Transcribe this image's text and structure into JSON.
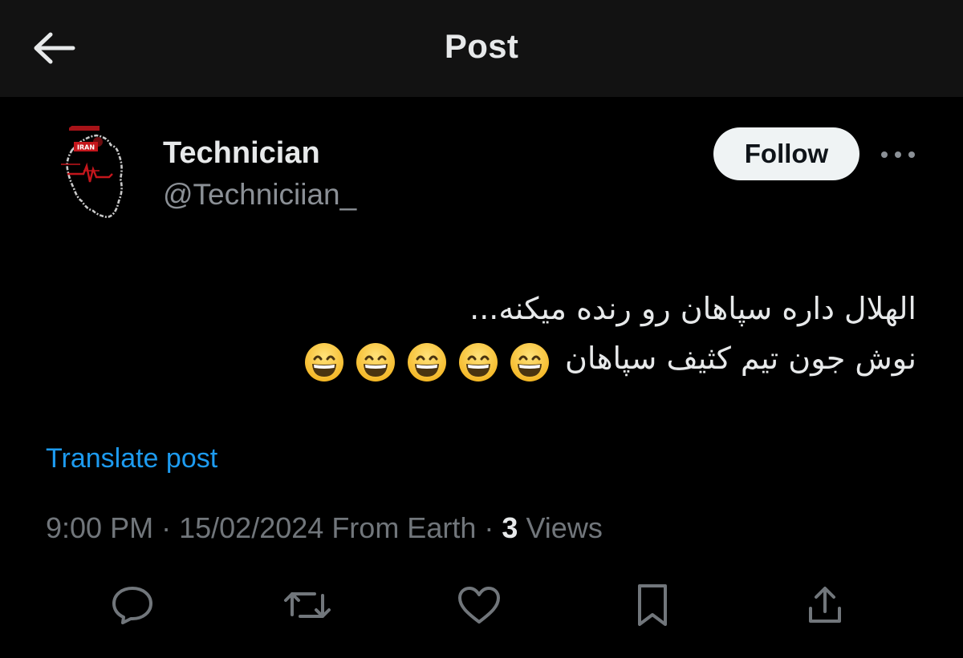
{
  "header": {
    "title": "Post",
    "back_icon": "arrow-left-icon"
  },
  "author": {
    "display_name": "Technician",
    "handle": "@Techniciian_",
    "avatar_text": "IRAN",
    "follow_label": "Follow",
    "more_icon": "more-horizontal-icon"
  },
  "post": {
    "line1": "الهلال داره سپاهان رو رنده میکنه...",
    "line2": "نوش جون تیم کثیف سپاهان",
    "emoji_name": "grinning-face-with-smiling-eyes-emoji",
    "emoji_count": 5,
    "translate_label": "Translate post",
    "time": "9:00 PM",
    "date": "15/02/2024",
    "source": "From Earth",
    "views_count": "3",
    "views_label": "Views",
    "separator": "·"
  },
  "actions": {
    "reply_icon": "reply-icon",
    "repost_icon": "repost-icon",
    "like_icon": "heart-icon",
    "bookmark_icon": "bookmark-icon",
    "share_icon": "share-icon"
  },
  "colors": {
    "background": "#000000",
    "header_background": "#121212",
    "text_primary": "#e7e9ea",
    "text_secondary": "#71767b",
    "link": "#1d9bf0",
    "follow_button_bg": "#eff3f4",
    "avatar_accent": "#c4161c"
  }
}
